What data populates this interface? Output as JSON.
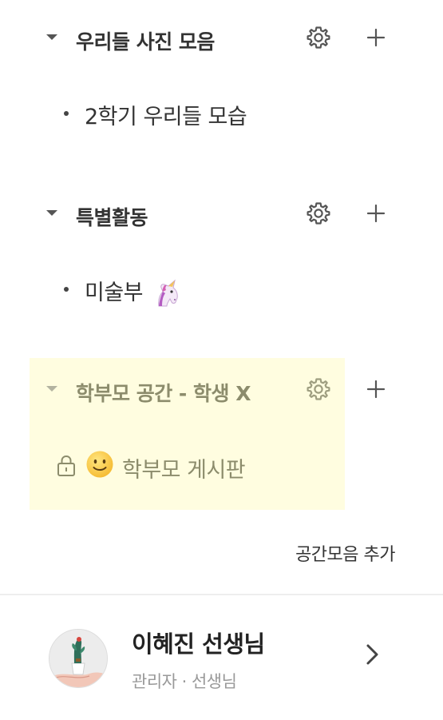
{
  "sections": [
    {
      "title": "우리들 사진 모음",
      "items": [
        {
          "label": "2학기 우리들 모습",
          "emoji": ""
        }
      ]
    },
    {
      "title": "특별활동",
      "items": [
        {
          "label": "미술부",
          "emoji": "unicorn-icon"
        }
      ]
    },
    {
      "title": "학부모 공간 - 학생 X",
      "highlight_color": "#fffde0",
      "items": [
        {
          "label": "학부모 게시판",
          "locked": true,
          "emoji": "slightly-smiling-face-icon"
        }
      ]
    }
  ],
  "add_group_label": "공간모음 추가",
  "profile": {
    "name": "이혜진 선생님",
    "role": "관리자 · 선생님"
  },
  "colors": {
    "muted_text": "#8c8c6c",
    "highlight_background": "#fffde0",
    "icon_gray": "#555555"
  }
}
